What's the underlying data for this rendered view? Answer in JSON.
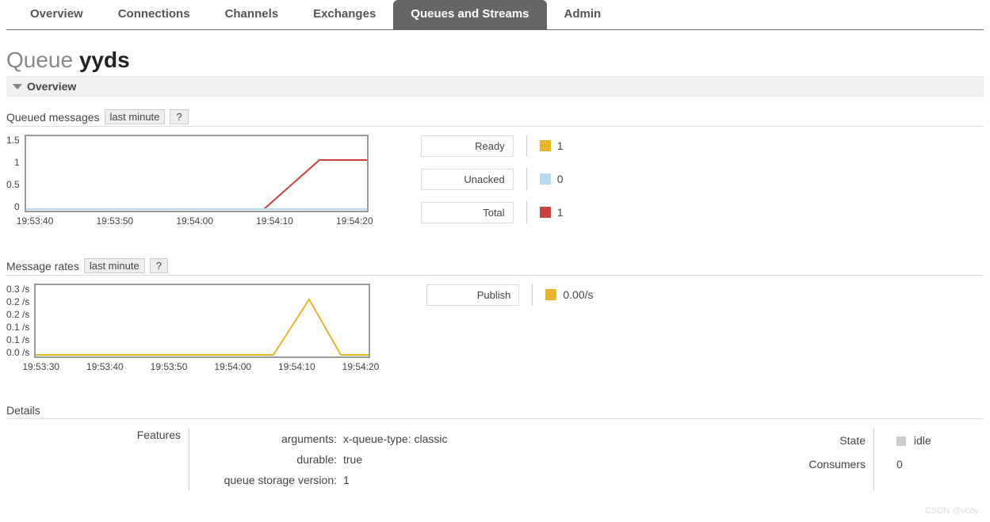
{
  "nav": {
    "tabs": [
      {
        "label": "Overview"
      },
      {
        "label": "Connections"
      },
      {
        "label": "Channels"
      },
      {
        "label": "Exchanges"
      },
      {
        "label": "Queues and Streams",
        "active": true
      },
      {
        "label": "Admin"
      }
    ]
  },
  "title": {
    "kind": "Queue",
    "name": "yyds"
  },
  "section_overview_label": "Overview",
  "chart1": {
    "title": "Queued messages",
    "range_label": "last minute",
    "help_label": "?",
    "legend": [
      {
        "label": "Ready",
        "color": "#e8b42a",
        "value": "1"
      },
      {
        "label": "Unacked",
        "color": "#b7d9ef",
        "value": "0"
      },
      {
        "label": "Total",
        "color": "#c9413b",
        "value": "1"
      }
    ]
  },
  "chart2": {
    "title": "Message rates",
    "range_label": "last minute",
    "help_label": "?",
    "legend": [
      {
        "label": "Publish",
        "color": "#e8b42a",
        "value": "0.00/s"
      }
    ]
  },
  "details": {
    "title": "Details",
    "features_label": "Features",
    "rows": [
      {
        "k": "arguments:",
        "v": "x-queue-type: classic"
      },
      {
        "k": "durable:",
        "v": "true"
      },
      {
        "k": "queue storage version:",
        "v": "1"
      }
    ],
    "state_label": "State",
    "state_value": "idle",
    "consumers_label": "Consumers",
    "consumers_value": "0"
  },
  "watermark": "CSDN @vcoy",
  "chart_data": [
    {
      "type": "line",
      "title": "Queued messages",
      "ylim": [
        0,
        1.5
      ],
      "yticks": [
        0.0,
        0.5,
        1.0,
        1.5
      ],
      "categories": [
        "19:53:40",
        "19:53:50",
        "19:54:00",
        "19:54:10",
        "19:54:20"
      ],
      "series": [
        {
          "name": "Ready",
          "color": "#e8b42a",
          "values": [
            0,
            0,
            0,
            0,
            0
          ]
        },
        {
          "name": "Unacked",
          "color": "#b7d9ef",
          "values": [
            0,
            0,
            0,
            0,
            0
          ]
        },
        {
          "name": "Total",
          "color": "#c9413b",
          "values": [
            0,
            0,
            0,
            1,
            1
          ]
        }
      ]
    },
    {
      "type": "line",
      "title": "Message rates",
      "ylim": [
        0,
        0.3
      ],
      "yticks": [
        "0.0 /s",
        "0.1 /s",
        "0.1 /s",
        "0.2 /s",
        "0.2 /s",
        "0.3 /s"
      ],
      "categories": [
        "19:53:30",
        "19:53:40",
        "19:53:50",
        "19:54:00",
        "19:54:10",
        "19:54:20"
      ],
      "series": [
        {
          "name": "Publish",
          "color": "#e8b42a",
          "values": [
            0,
            0,
            0,
            0,
            0.2,
            0
          ]
        }
      ]
    }
  ]
}
